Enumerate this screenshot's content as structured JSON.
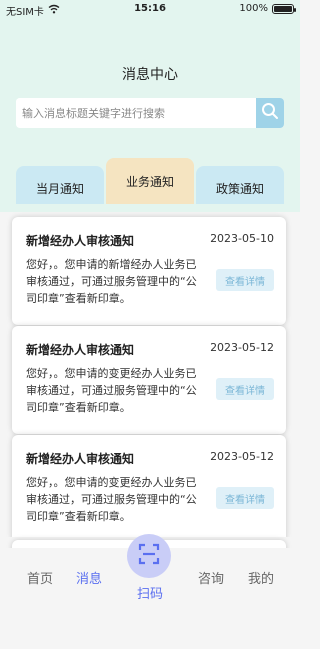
{
  "status_bar": {
    "carrier": "无SIM卡",
    "time": "15:16",
    "battery": "100%"
  },
  "page": {
    "title": "消息中心"
  },
  "search": {
    "placeholder": "输入消息标题关键字进行搜索"
  },
  "tabs": [
    {
      "label": "当月通知",
      "active": false
    },
    {
      "label": "业务通知",
      "active": true
    },
    {
      "label": "政策通知",
      "active": false
    }
  ],
  "notifications": [
    {
      "title": "新增经办人审核通知",
      "date": "2023-05-10",
      "body": "您好，。您申请的新增经办人业务已审核通过，可通过服务管理中的“公司印章”查看新印章。",
      "action": "查看详情"
    },
    {
      "title": "新增经办人审核通知",
      "date": "2023-05-12",
      "body": "您好，。您申请的变更经办人业务已审核通过，可通过服务管理中的“公司印章”查看新印章。",
      "action": "查看详情"
    },
    {
      "title": "新增经办人审核通知",
      "date": "2023-05-12",
      "body": "您好，。您申请的变更经办人业务已审核通过，可通过服务管理中的“公司印章”查看新印章。",
      "action": "查看详情"
    }
  ],
  "bottom_nav": {
    "home": "首页",
    "messages": "消息",
    "scan": "扫码",
    "consult": "咨询",
    "mine": "我的",
    "active": "messages"
  },
  "icons": {
    "wifi": "wifi-icon",
    "battery": "battery-icon",
    "search": "search-icon",
    "scan": "scan-icon"
  },
  "colors": {
    "header_bg": "#e3f5ef",
    "tab_bg": "#cbe9f3",
    "tab_active_bg": "#f5e4c1",
    "accent": "#5a6ff0",
    "search_button": "#9fd3e8"
  }
}
